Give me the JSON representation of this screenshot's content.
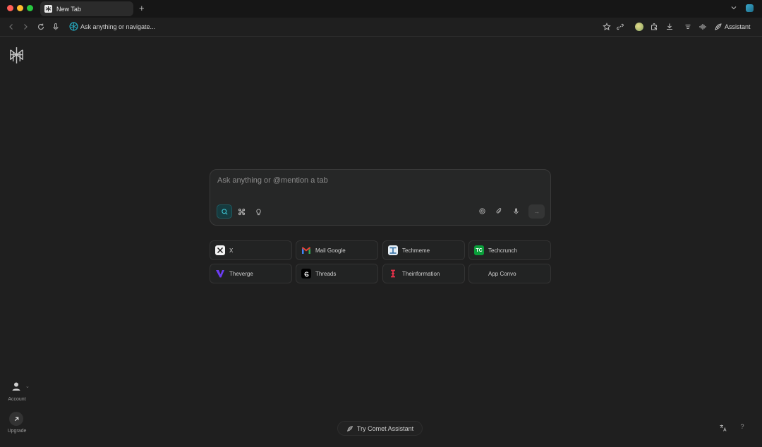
{
  "browser": {
    "tab": {
      "title": "New Tab"
    },
    "new_tab_symbol": "+",
    "toolbar": {
      "omnibox_text": "Ask anything or navigate...",
      "assistant_label": "Assistant"
    }
  },
  "sidebar": {
    "account_label": "Account",
    "upgrade_label": "Upgrade"
  },
  "search": {
    "placeholder": "Ask anything or @mention a tab",
    "modes": [
      "search-icon",
      "focus-grid-icon",
      "lightbulb-icon"
    ],
    "actions": [
      "globe-icon",
      "paperclip-icon",
      "microphone-icon"
    ],
    "submit_symbol": "→"
  },
  "shortcuts": [
    {
      "label": "X",
      "icon": "x-logo-icon"
    },
    {
      "label": "Mail Google",
      "icon": "gmail-icon"
    },
    {
      "label": "Techmeme",
      "icon": "techmeme-icon"
    },
    {
      "label": "Techcrunch",
      "icon": "techcrunch-icon",
      "badge": "TC"
    },
    {
      "label": "Theverge",
      "icon": "verge-icon"
    },
    {
      "label": "Threads",
      "icon": "threads-icon"
    },
    {
      "label": "Theinformation",
      "icon": "theinformation-icon"
    },
    {
      "label": "App Convo",
      "icon": ""
    }
  ],
  "footer": {
    "try_assistant_label": "Try Comet Assistant",
    "help_symbol": "?"
  },
  "colors": {
    "accent": "#1f5a60",
    "background": "#1f1f1f"
  }
}
